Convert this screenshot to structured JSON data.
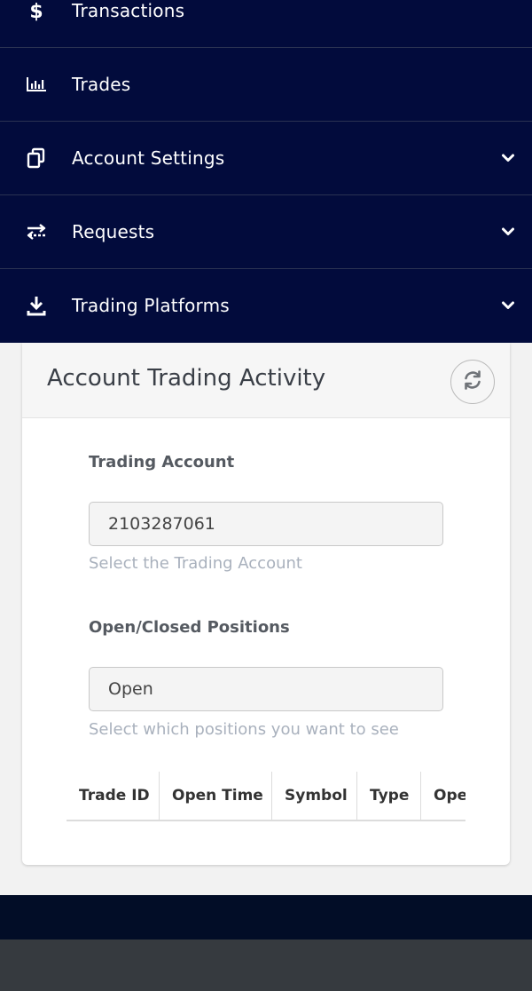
{
  "nav": {
    "items": [
      {
        "label": "Transactions",
        "icon": "dollar-icon",
        "has_chevron": false
      },
      {
        "label": "Trades",
        "icon": "bar-chart-icon",
        "has_chevron": false
      },
      {
        "label": "Account Settings",
        "icon": "copy-icon",
        "has_chevron": true
      },
      {
        "label": "Requests",
        "icon": "exchange-icon",
        "has_chevron": true
      },
      {
        "label": "Trading Platforms",
        "icon": "download-icon",
        "has_chevron": true
      }
    ]
  },
  "card": {
    "title": "Account Trading Activity",
    "refresh_icon": "refresh-icon",
    "trading_account": {
      "label": "Trading Account",
      "value": "2103287061",
      "help": "Select the Trading Account"
    },
    "positions": {
      "label": "Open/Closed Positions",
      "value": "Open",
      "help": "Select which positions you want to see"
    },
    "table": {
      "columns": [
        "Trade ID",
        "Open Time",
        "Symbol",
        "Type",
        "Ope"
      ]
    }
  },
  "colors": {
    "nav_bg": "#020b3c",
    "footer_dark": "#020d27",
    "footer_gray": "#363a3f"
  }
}
